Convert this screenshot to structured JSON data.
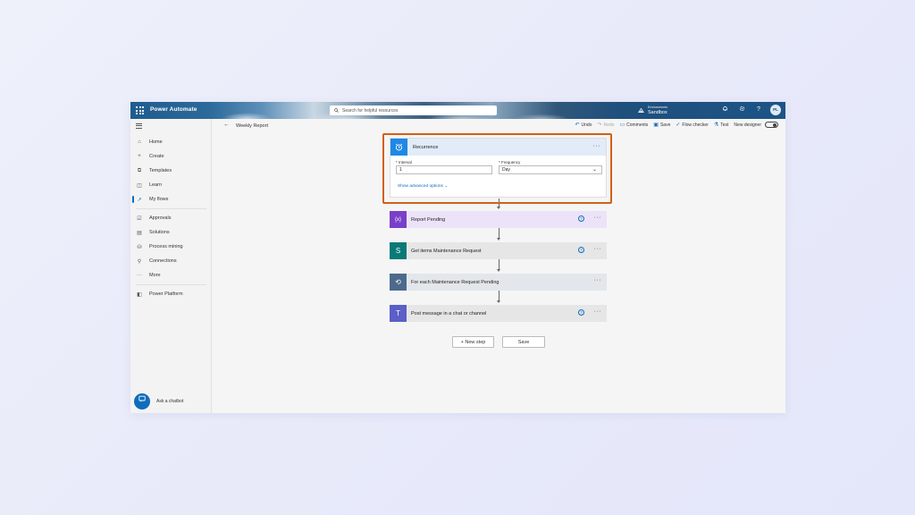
{
  "app": {
    "brand": "Power Automate",
    "avatar_initials": "PL"
  },
  "search": {
    "placeholder": "Search for helpful resources"
  },
  "environment": {
    "label": "Environments",
    "value": "Sandbox"
  },
  "sidebar": {
    "items": [
      {
        "label": "Home",
        "icon": "home-icon"
      },
      {
        "label": "Create",
        "icon": "plus-icon"
      },
      {
        "label": "Templates",
        "icon": "templates-icon"
      },
      {
        "label": "Learn",
        "icon": "book-icon"
      },
      {
        "label": "My flows",
        "icon": "flow-icon",
        "active": true
      },
      {
        "label": "Approvals",
        "icon": "approvals-icon"
      },
      {
        "label": "Solutions",
        "icon": "solutions-icon"
      },
      {
        "label": "Process mining",
        "icon": "process-mining-icon"
      },
      {
        "label": "Connections",
        "icon": "connections-icon"
      },
      {
        "label": "More",
        "icon": "more-icon"
      },
      {
        "label": "Power Platform",
        "icon": "power-platform-icon"
      }
    ],
    "chatbot": "Ask a chatbot"
  },
  "flow": {
    "name": "Weekly Report"
  },
  "commands": {
    "undo": "Undo",
    "redo": "Redo",
    "comments": "Comments",
    "save": "Save",
    "flow_checker": "Flow checker",
    "test": "Test",
    "new_designer": "New designer"
  },
  "recurrence": {
    "title": "Recurrence",
    "interval_label": "* Interval",
    "interval_value": "1",
    "frequency_label": "* Frequency",
    "frequency_value": "Day",
    "advanced": "Show advanced options"
  },
  "steps": [
    {
      "title": "Report Pending",
      "color": "#7a3fc8",
      "header": "#ece3f8",
      "icon": "variable-icon",
      "glyph": "{x}",
      "help": true
    },
    {
      "title": "Get items Maintenance Request",
      "color": "#0a7a78",
      "header": "#e6e6e6",
      "icon": "sharepoint-icon",
      "glyph": "S",
      "help": true
    },
    {
      "title": "For each Maintenance Request Pending",
      "color": "#4d6a8c",
      "header": "#e3e7ec",
      "icon": "loop-icon",
      "glyph": "⟲",
      "help": false
    },
    {
      "title": "Post message in a chat or channel",
      "color": "#5b5fc7",
      "header": "#e6e6e6",
      "icon": "teams-icon",
      "glyph": "T",
      "help": true
    }
  ],
  "actions": {
    "new_step": "+ New step",
    "save": "Save"
  }
}
